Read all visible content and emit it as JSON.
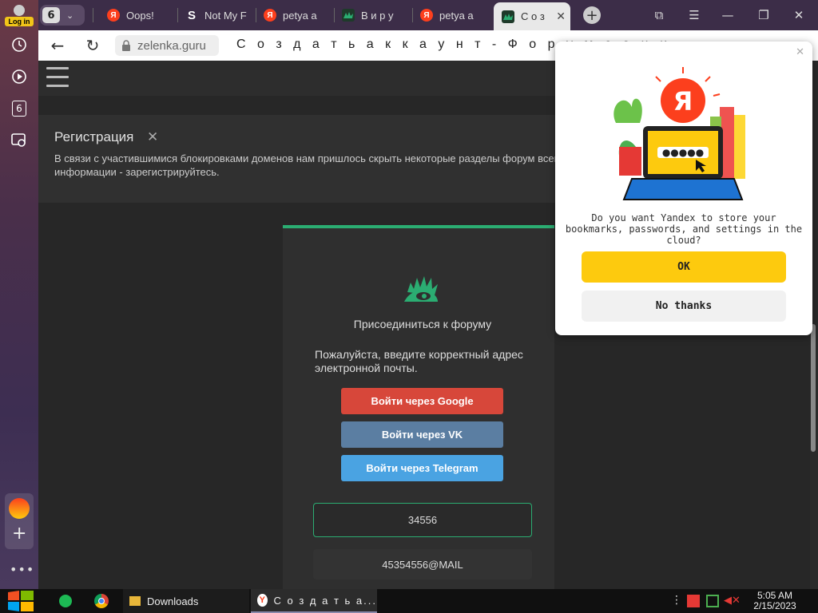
{
  "sidebar": {
    "login_badge": "Log in",
    "tab_count": "6",
    "more": "•••"
  },
  "tabs": {
    "counter": "6",
    "items": [
      {
        "label": "Oops!",
        "icon": "yandex-icon"
      },
      {
        "label": "Not My F",
        "icon": "s-icon"
      },
      {
        "label": "petya a",
        "icon": "yandex-icon"
      },
      {
        "label": "В и р у",
        "icon": "lolz-icon"
      },
      {
        "label": "petya a",
        "icon": "yandex-icon"
      },
      {
        "label": "С о з",
        "icon": "lolz-icon"
      }
    ]
  },
  "addressbar": {
    "domain": "zelenka.guru",
    "title": "С о з д а т ь   а к к а у н т  -  Ф о р у м   с о ц и"
  },
  "notice": {
    "title": "Регистрация",
    "text": "В связи с участившимися блокировками доменов нам пришлось скрыть некоторые разделы форум всей информации - зарегистрируйтесь."
  },
  "registration": {
    "join_title": "Присоединиться к форуму",
    "email_hint": "Пожалуйста, введите корректный адрес электронной почты.",
    "google": "Войти через Google",
    "vk": "Войти через VK",
    "telegram": "Войти через Telegram",
    "login_value": "34556",
    "email_value": "45354556@MAIL"
  },
  "popup": {
    "text": "Do you want Yandex to store your bookmarks, passwords, and settings in the cloud?",
    "ok": "OK",
    "no": "No thanks",
    "logo_letter": "Я"
  },
  "taskbar": {
    "downloads": "Downloads",
    "yandex_window": "С о з д а т ь   а...",
    "time": "5:05 AM",
    "date": "2/15/2023"
  },
  "colors": {
    "accent_green": "#2bad72",
    "google": "#d7473a",
    "vk": "#5b7ea2",
    "telegram": "#4aa3e2",
    "yandex_yellow": "#fdca0e",
    "yandex_red": "#fc3f1d"
  }
}
